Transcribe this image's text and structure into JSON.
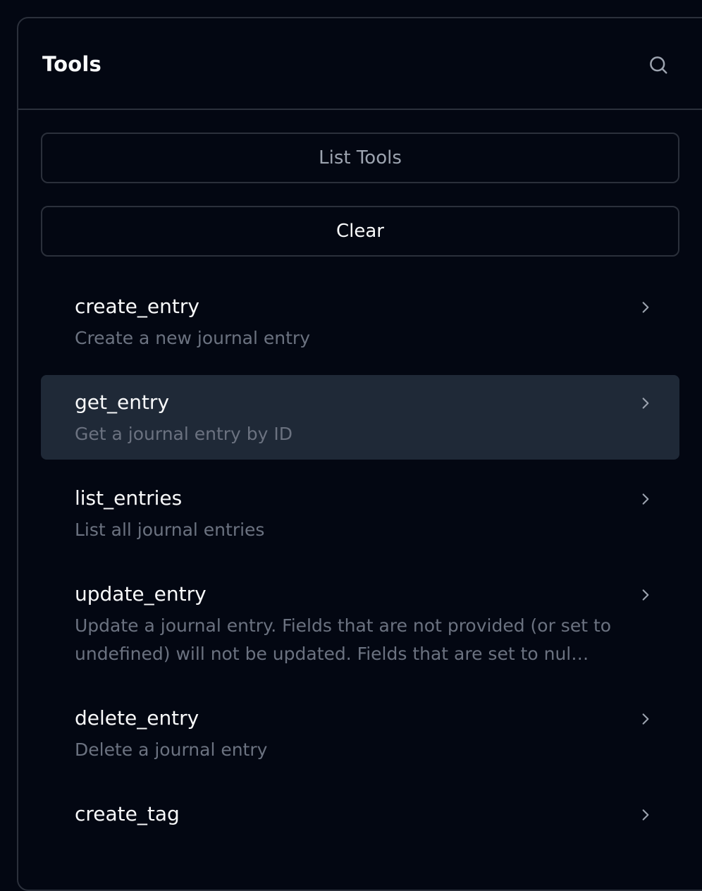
{
  "header": {
    "title": "Tools"
  },
  "actions": {
    "list_tools_label": "List Tools",
    "clear_label": "Clear"
  },
  "tools": [
    {
      "name": "create_entry",
      "description": "Create a new journal entry"
    },
    {
      "name": "get_entry",
      "description": "Get a journal entry by ID",
      "selected": true
    },
    {
      "name": "list_entries",
      "description": "List all journal entries"
    },
    {
      "name": "update_entry",
      "description": "Update a journal entry. Fields that are not provided (or set to undefined) will not be updated. Fields that are set to nul…"
    },
    {
      "name": "delete_entry",
      "description": "Delete a journal entry"
    },
    {
      "name": "create_tag",
      "description": ""
    }
  ],
  "icons": {
    "search": "search-icon",
    "chevron": "chevron-right-icon"
  },
  "colors": {
    "background": "#030712",
    "border": "#2b303b",
    "selected_row": "#1f2937",
    "primary_text": "#f9fafb",
    "secondary_text": "#6b7280"
  }
}
